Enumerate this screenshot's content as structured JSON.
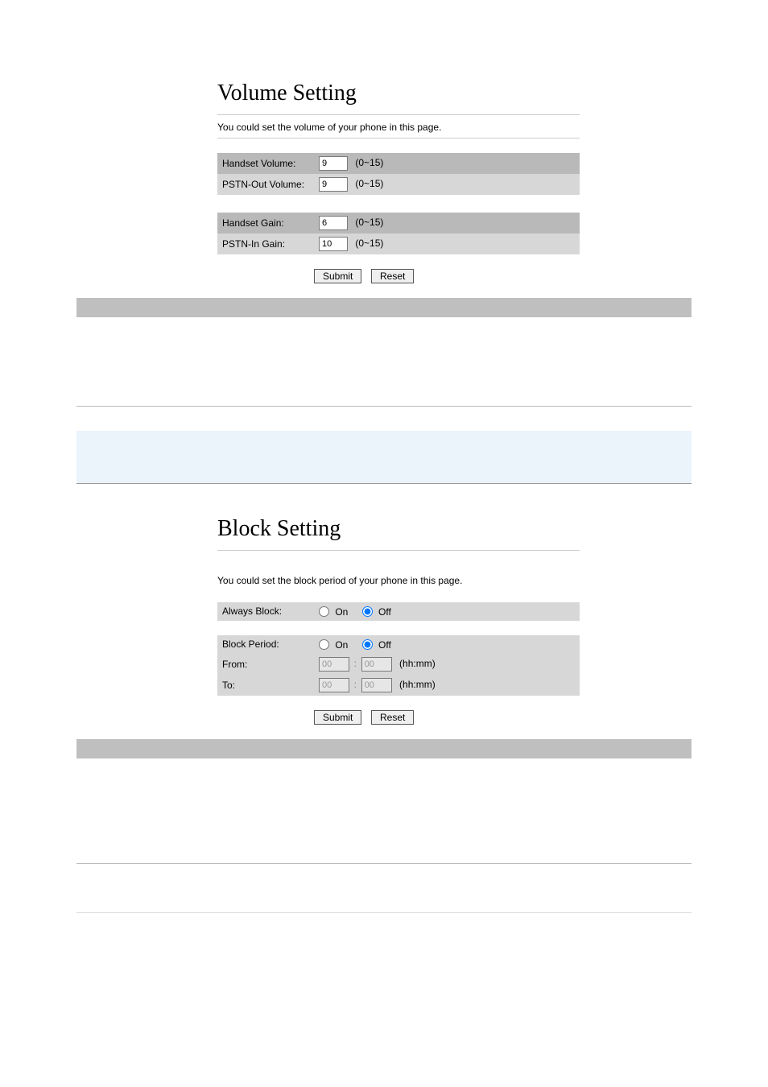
{
  "volume_panel": {
    "title": "Volume Setting",
    "desc": "You could set the volume of your phone in this page.",
    "rows": {
      "handset_volume": {
        "label": "Handset Volume:",
        "value": "9",
        "range": "(0~15)"
      },
      "pstn_out_volume": {
        "label": "PSTN-Out Volume:",
        "value": "9",
        "range": "(0~15)"
      },
      "handset_gain": {
        "label": "Handset Gain:",
        "value": "6",
        "range": "(0~15)"
      },
      "pstn_in_gain": {
        "label": "PSTN-In Gain:",
        "value": "10",
        "range": "(0~15)"
      }
    },
    "submit": "Submit",
    "reset": "Reset"
  },
  "block_panel": {
    "title": "Block Setting",
    "desc": "You could set the block period of your phone in this page.",
    "always_block": {
      "label": "Always Block:",
      "on": "On",
      "off": "Off"
    },
    "block_period": {
      "label": "Block Period:",
      "on": "On",
      "off": "Off"
    },
    "from": {
      "label": "From:",
      "hh": "00",
      "mm": "00",
      "hint": "(hh:mm)"
    },
    "to": {
      "label": "To:",
      "hh": "00",
      "mm": "00",
      "hint": "(hh:mm)"
    },
    "submit": "Submit",
    "reset": "Reset"
  }
}
